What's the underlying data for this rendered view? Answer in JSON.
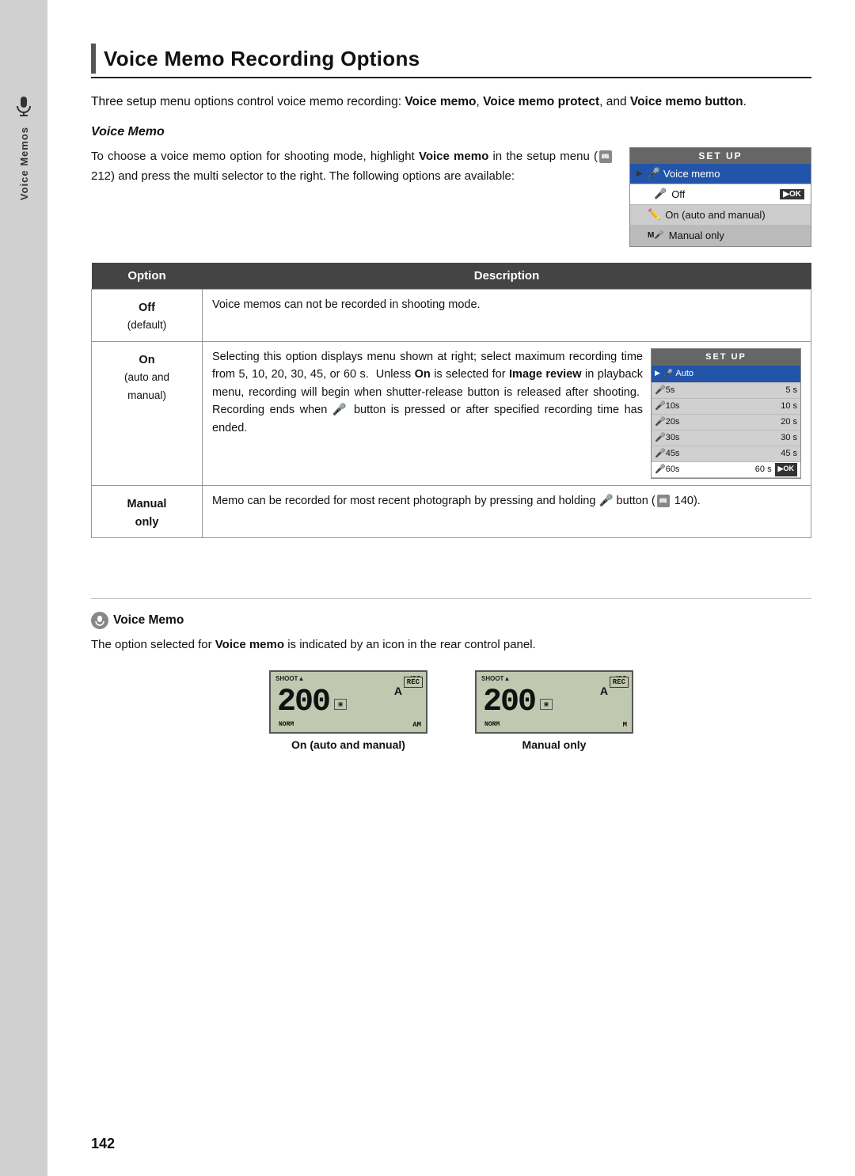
{
  "page": {
    "number": "142",
    "title": "Voice Memo Recording Options",
    "intro": "Three setup menu options control voice memo recording: ",
    "intro_bold1": "Voice memo",
    "intro_mid": ", ",
    "intro_bold2": "Voice memo protect",
    "intro_mid2": ", and ",
    "intro_bold3": "Voice memo button",
    "intro_end": "."
  },
  "voice_memo_section": {
    "heading": "Voice Memo",
    "body_before_bold": "To choose a voice memo option for shooting mode, highlight ",
    "bold_text": "Voice memo",
    "body_after_bold": " in the setup menu (",
    "page_ref": "212",
    "body_end": ") and press the multi selector to the right. The following options are available:"
  },
  "setup_menu_1": {
    "header": "SET  UP",
    "selected_item": "Voice memo",
    "items": [
      {
        "label": "Off",
        "selected": true,
        "ok": true
      },
      {
        "label": "On (auto and manual)",
        "selected": false
      },
      {
        "label": "Manual only",
        "selected": false,
        "icon": "M"
      }
    ]
  },
  "table": {
    "col_option": "Option",
    "col_description": "Description",
    "rows": [
      {
        "option": "Off",
        "option_sub": "(default)",
        "description": "Voice memos can not be recorded in shooting mode."
      },
      {
        "option": "On",
        "option_sub2": "(auto and",
        "option_sub3": "manual)",
        "description_before": "Selecting this option displays menu shown at right; select maximum recording time from 5, 10, 20, 30, 45, or 60 s.  Unless ",
        "description_bold": "On",
        "description_after": " is selected for ",
        "description_bold2": "Image review",
        "description_after2": " in playback menu, recording will begin when shutter-release button is released after shooting.  Recording ends when",
        "description_after3": " button is pressed or after specified recording time has ended.",
        "has_screen": true
      },
      {
        "option": "Manual",
        "option_sub": "only",
        "description_before": "Memo can be recorded for most recent photograph by pressing and holding",
        "description_after": " button (",
        "page_ref": "140",
        "description_end": ")."
      }
    ]
  },
  "setup_menu_2": {
    "header": "SET  UP",
    "selected_item": "Auto",
    "rows": [
      {
        "code": "5s",
        "label": "5 s",
        "selected": false
      },
      {
        "code": "10s",
        "label": "10 s",
        "selected": false
      },
      {
        "code": "20s",
        "label": "20 s",
        "selected": false
      },
      {
        "code": "30s",
        "label": "30 s",
        "selected": false
      },
      {
        "code": "45s",
        "label": "45 s",
        "selected": false
      },
      {
        "code": "60s",
        "label": "60 s",
        "selected": true,
        "ok": true
      }
    ]
  },
  "note_section": {
    "heading": "Voice Memo",
    "body_before": "The option selected for ",
    "body_bold": "Voice memo",
    "body_after": " is indicated by an icon in the rear control panel."
  },
  "lcd_panels": [
    {
      "label": "On (auto and manual)",
      "iso_label": "ISO",
      "shoot_label": "SHOOT A",
      "number": "200",
      "norm": "NORM",
      "a_label": "A",
      "rec_label": "REC",
      "am_label": "AM"
    },
    {
      "label": "Manual only",
      "iso_label": "ISO",
      "shoot_label": "SHOOT A",
      "number": "200",
      "norm": "NORM",
      "a_label": "A",
      "rec_label": "REC",
      "m_label": "M"
    }
  ],
  "sidebar": {
    "label": "Voice Memos"
  }
}
